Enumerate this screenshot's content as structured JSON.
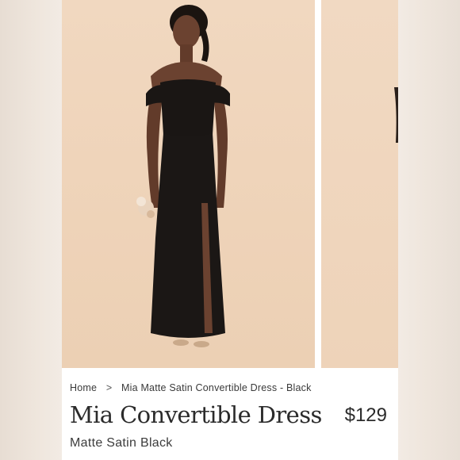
{
  "breadcrumb": {
    "home": "Home",
    "separator": ">",
    "current": "Mia Matte Satin Convertible Dress - Black"
  },
  "product": {
    "title": "Mia Convertible Dress",
    "price": "$129",
    "variant": "Matte Satin Black"
  },
  "colors": {
    "photo_background": "#efd4ba",
    "dress": "#1a1614",
    "text": "#2b2b2b"
  }
}
